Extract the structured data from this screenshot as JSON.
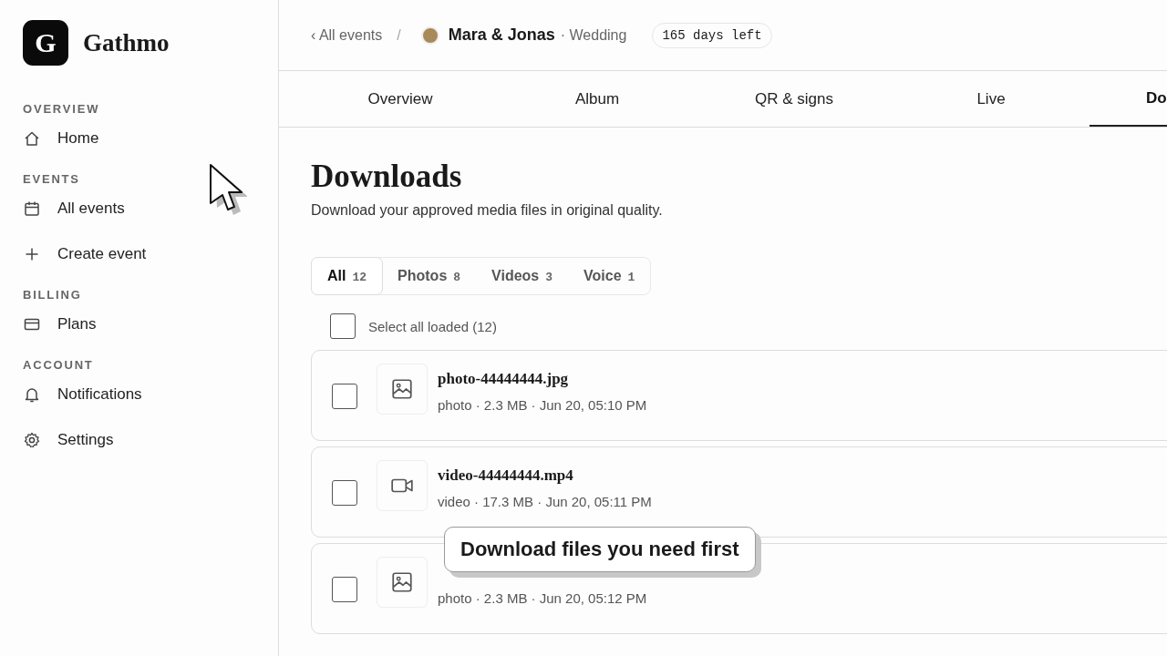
{
  "app": {
    "logo_letter": "G",
    "name": "Gathmo"
  },
  "sidebar": {
    "sections": [
      {
        "label": "OVERVIEW",
        "items": [
          {
            "label": "Home",
            "kind": "home"
          }
        ]
      },
      {
        "label": "EVENTS",
        "items": [
          {
            "label": "All events",
            "kind": "calendar"
          },
          {
            "label": "Create event",
            "kind": "plus"
          }
        ]
      },
      {
        "label": "BILLING",
        "items": [
          {
            "label": "Plans",
            "kind": "card"
          }
        ]
      },
      {
        "label": "ACCOUNT",
        "items": [
          {
            "label": "Notifications",
            "kind": "bell"
          },
          {
            "label": "Settings",
            "kind": "gear"
          }
        ]
      }
    ]
  },
  "header": {
    "back_link": "‹ All events",
    "separator": "/",
    "event": {
      "name": "Mara & Jonas",
      "type": "· Wedding",
      "color": "#a8895a"
    },
    "countdown": "165 days left"
  },
  "tabs": [
    {
      "label": "Overview",
      "selected": false
    },
    {
      "label": "Album",
      "selected": false
    },
    {
      "label": "QR & signs",
      "selected": false
    },
    {
      "label": "Live",
      "selected": false
    },
    {
      "label": "Do",
      "selected": true
    }
  ],
  "page": {
    "title": "Downloads",
    "subtitle": "Download your approved media files in original quality."
  },
  "filters": [
    {
      "label": "All",
      "count": "12",
      "selected": true
    },
    {
      "label": "Photos",
      "count": "8",
      "selected": false
    },
    {
      "label": "Videos",
      "count": "3",
      "selected": false
    },
    {
      "label": "Voice",
      "count": "1",
      "selected": false
    }
  ],
  "select_all": {
    "label": "Select all loaded (12)",
    "checked": false
  },
  "files": [
    {
      "kind": "photo",
      "name": "photo-44444444.jpg",
      "meta": "photo · 2.3 MB · Jun 20, 05:10 PM",
      "checked": false
    },
    {
      "kind": "video",
      "name": "video-44444444.mp4",
      "meta": "video · 17.3 MB · Jun 20, 05:11 PM",
      "checked": false
    },
    {
      "kind": "photo",
      "meta": "photo · 2.3 MB · Jun 20, 05:12 PM",
      "checked": false
    }
  ],
  "tooltip": "Download files you need first"
}
